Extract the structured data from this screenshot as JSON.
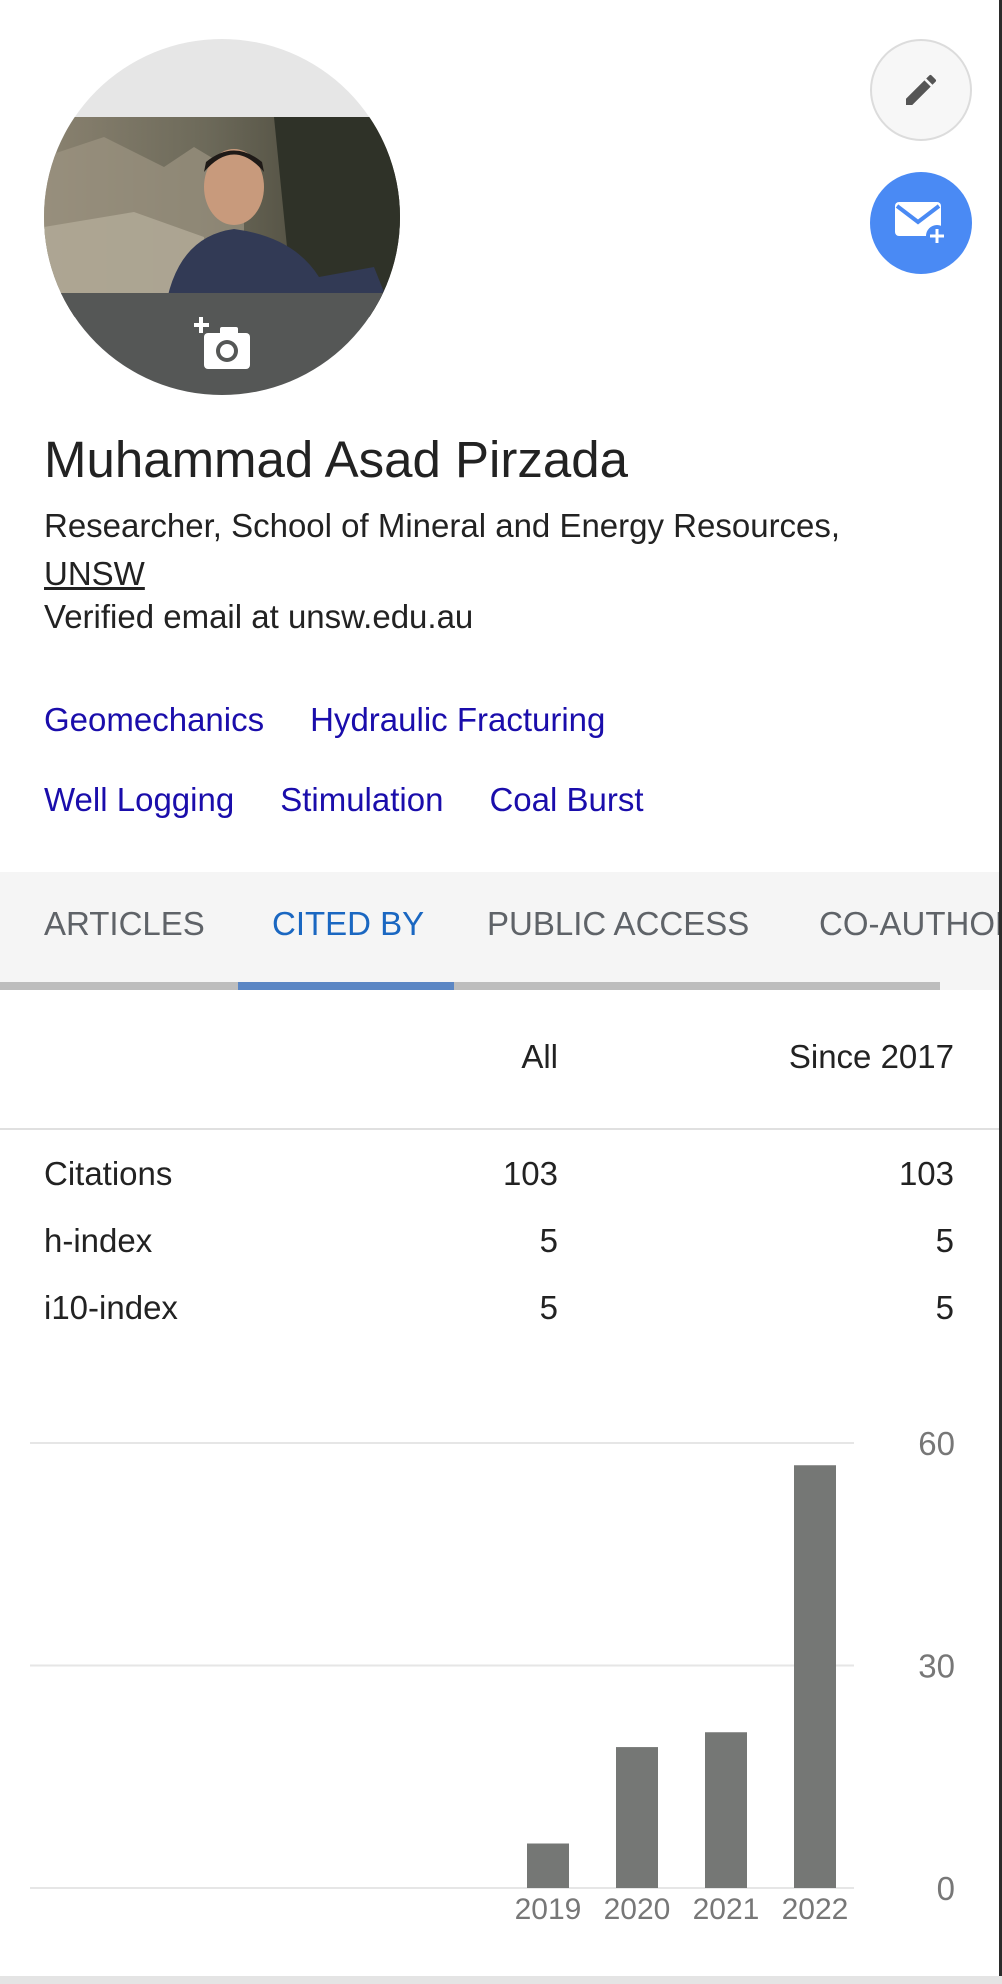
{
  "profile": {
    "name": "Muhammad Asad Pirzada",
    "affiliation_prefix": "Researcher, School of Mineral and Energy Resources,",
    "affiliation_org": "UNSW",
    "verified_email": "Verified email at unsw.edu.au"
  },
  "actions": {
    "edit_icon": "pencil-icon",
    "follow_icon": "mail-plus-icon",
    "photo_icon": "camera-plus-icon",
    "accent_color": "#4a8af4"
  },
  "interests": {
    "row1": [
      "Geomechanics",
      "Hydraulic Fracturing"
    ],
    "row2": [
      "Well Logging",
      "Stimulation",
      "Coal Burst"
    ]
  },
  "tabs": {
    "articles": "ARTICLES",
    "cited_by": "CITED BY",
    "public_access": "PUBLIC ACCESS",
    "co_authors": "CO-AUTHORS",
    "active": "cited_by"
  },
  "stats": {
    "header_all": "All",
    "header_since": "Since 2017",
    "rows": [
      {
        "label": "Citations",
        "all": "103",
        "since": "103"
      },
      {
        "label": "h-index",
        "all": "5",
        "since": "5"
      },
      {
        "label": "i10-index",
        "all": "5",
        "since": "5"
      }
    ]
  },
  "chart_data": {
    "type": "bar",
    "categories": [
      "2019",
      "2020",
      "2021",
      "2022"
    ],
    "values": [
      6,
      19,
      21,
      57
    ],
    "ylim": [
      0,
      60
    ],
    "yticks": [
      "0",
      "30",
      "60"
    ],
    "grid": true,
    "bar_color": "#757775"
  }
}
